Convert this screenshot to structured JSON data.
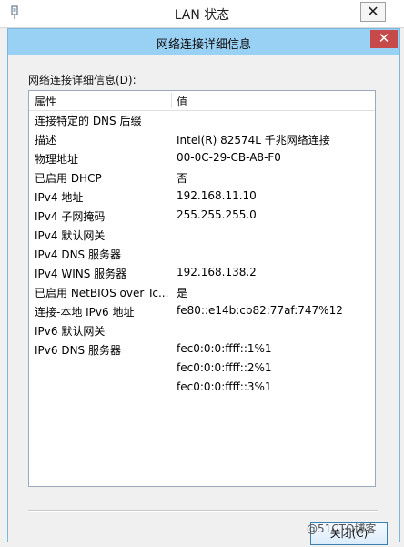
{
  "background_window": {
    "title": "LAN 状态",
    "close_glyph": "✕"
  },
  "dialog": {
    "title": "网络连接详细信息",
    "close_glyph": "✕",
    "details_label": "网络连接详细信息(D):",
    "columns": {
      "property": "属性",
      "value": "值"
    },
    "rows": [
      {
        "property": "连接特定的 DNS 后缀",
        "value": ""
      },
      {
        "property": "描述",
        "value": "Intel(R) 82574L 千兆网络连接"
      },
      {
        "property": "物理地址",
        "value": "00-0C-29-CB-A8-F0"
      },
      {
        "property": "已启用 DHCP",
        "value": "否"
      },
      {
        "property": "IPv4 地址",
        "value": "192.168.11.10"
      },
      {
        "property": "IPv4 子网掩码",
        "value": "255.255.255.0"
      },
      {
        "property": "IPv4 默认网关",
        "value": ""
      },
      {
        "property": "IPv4 DNS 服务器",
        "value": ""
      },
      {
        "property": "IPv4 WINS 服务器",
        "value": "192.168.138.2"
      },
      {
        "property": "已启用 NetBIOS over Tc...",
        "value": "是"
      },
      {
        "property": "连接-本地 IPv6 地址",
        "value": "fe80::e14b:cb82:77af:747%12"
      },
      {
        "property": "IPv6 默认网关",
        "value": ""
      },
      {
        "property": "IPv6 DNS 服务器",
        "value": "fec0:0:0:ffff::1%1"
      },
      {
        "property": "",
        "value": "fec0:0:0:ffff::2%1"
      },
      {
        "property": "",
        "value": "fec0:0:0:ffff::3%1"
      }
    ],
    "close_button": "关闭(C)"
  },
  "watermark": "@51CTO博客",
  "colors": {
    "dialog_titlebar": "#99d1f4",
    "close_button_bg": "#c74a4a",
    "window_bg": "#f0f0f0",
    "button_border": "#3c7fb1"
  }
}
